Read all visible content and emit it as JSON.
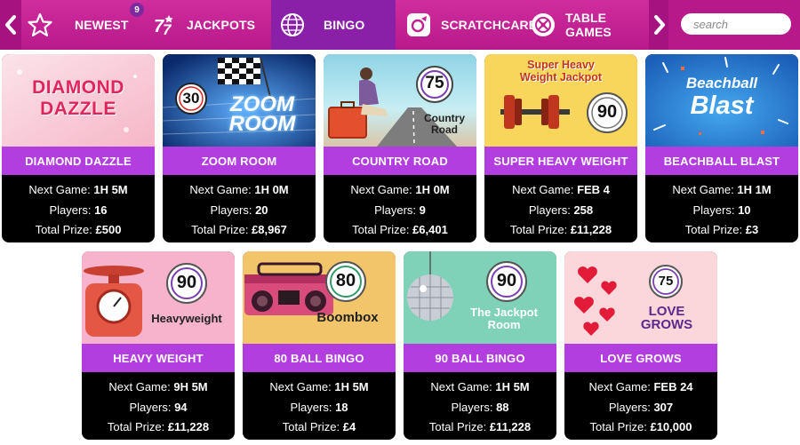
{
  "nav": {
    "tabs": [
      {
        "id": "newest",
        "label": "NEWEST",
        "badge": "9"
      },
      {
        "id": "jackpots",
        "label": "JACKPOTS"
      },
      {
        "id": "bingo",
        "label": "BINGO",
        "active": true
      },
      {
        "id": "scratchcards",
        "label": "SCRATCHCARDS"
      },
      {
        "id": "table-games",
        "label": "TABLE GAMES"
      }
    ],
    "search_placeholder": "search"
  },
  "labels": {
    "next_game": "Next Game:",
    "players": "Players:",
    "total_prize": "Total Prize:"
  },
  "games": [
    {
      "name": "DIAMOND DAZZLE",
      "next_game": "1H 5M",
      "players": "16",
      "prize": "£500",
      "art_text": "DIAMOND DAZZLE"
    },
    {
      "name": "ZOOM ROOM",
      "next_game": "1H 0M",
      "players": "20",
      "prize": "£8,967",
      "ball": "30",
      "art_text": "ZOOM ROOM"
    },
    {
      "name": "COUNTRY ROAD",
      "next_game": "1H 0M",
      "players": "9",
      "prize": "£6,401",
      "ball": "75",
      "art_text": "Country Road"
    },
    {
      "name": "SUPER HEAVY WEIGHT",
      "next_game": "FEB 4",
      "players": "258",
      "prize": "£11,228",
      "ball": "90",
      "art_text": "Super Heavy Weight Jackpot"
    },
    {
      "name": "BEACHBALL BLAST",
      "next_game": "1H 1M",
      "players": "10",
      "prize": "£3",
      "art_text": "Beachball Blast"
    },
    {
      "name": "HEAVY WEIGHT",
      "next_game": "9H 5M",
      "players": "94",
      "prize": "£11,228",
      "ball": "90",
      "art_text": "Heavyweight"
    },
    {
      "name": "80 BALL BINGO",
      "next_game": "1H 5M",
      "players": "18",
      "prize": "£4",
      "ball": "80",
      "art_text": "Boombox"
    },
    {
      "name": "90 BALL BINGO",
      "next_game": "1H 5M",
      "players": "88",
      "prize": "£11,228",
      "ball": "90",
      "art_text": "The Jackpot Room"
    },
    {
      "name": "LOVE GROWS",
      "next_game": "FEB 24",
      "players": "307",
      "prize": "£10,000",
      "ball": "75",
      "art_text": "LOVE GROWS"
    }
  ],
  "colors": {
    "nav": "#c2218f",
    "active_tab": "#8a1fa8",
    "name_bar": "#b33ee0",
    "card_bg": "#000000"
  }
}
